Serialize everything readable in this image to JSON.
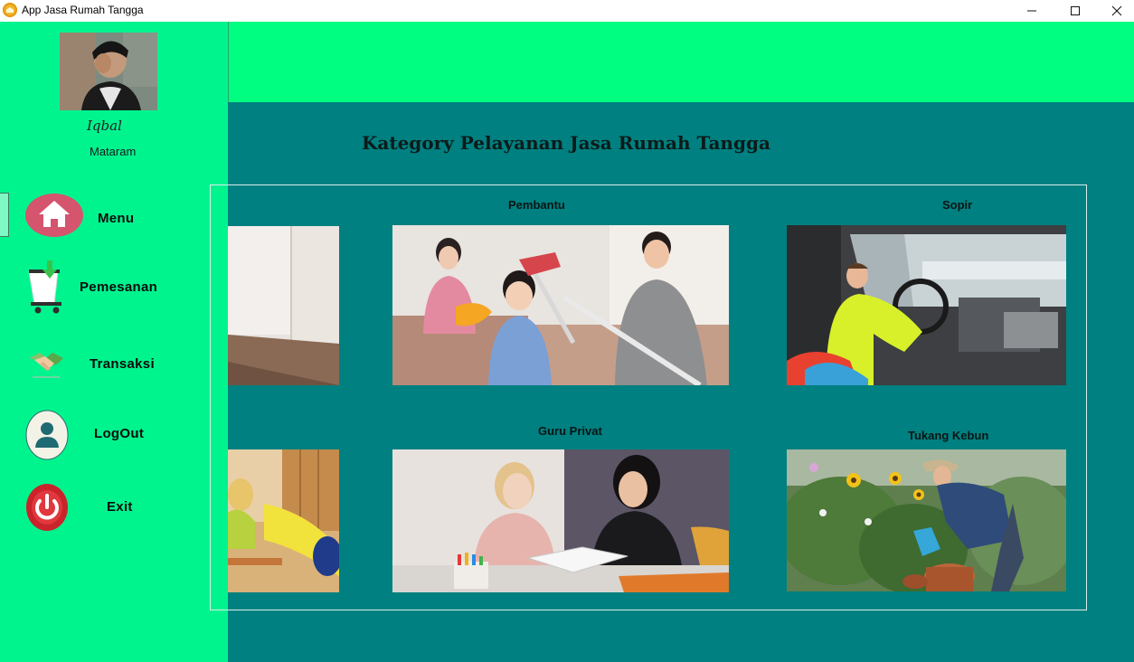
{
  "window": {
    "title": "App Jasa Rumah Tangga",
    "controls": [
      "minimize-icon",
      "maximize-icon",
      "close-icon"
    ]
  },
  "sidebar": {
    "user": {
      "name": "Iqbal",
      "city": "Mataram"
    },
    "items": [
      {
        "label": "Menu",
        "icon": "home-icon"
      },
      {
        "label": "Pemesanan",
        "icon": "shopping-cart-icon"
      },
      {
        "label": "Transaksi",
        "icon": "handshake-icon"
      },
      {
        "label": "LogOut",
        "icon": "user-icon"
      },
      {
        "label": "Exit",
        "icon": "power-icon"
      }
    ]
  },
  "main": {
    "title": "Kategory Pelayanan Jasa Rumah Tangga",
    "categories": [
      {
        "label": "Pembantu"
      },
      {
        "label": "Sopir"
      },
      {
        "label": "Guru Privat"
      },
      {
        "label": "Tukang Kebun"
      }
    ]
  },
  "colors": {
    "sidebar_bg": "#00f48e",
    "header_bg": "#00ff80",
    "main_bg": "#008080"
  }
}
